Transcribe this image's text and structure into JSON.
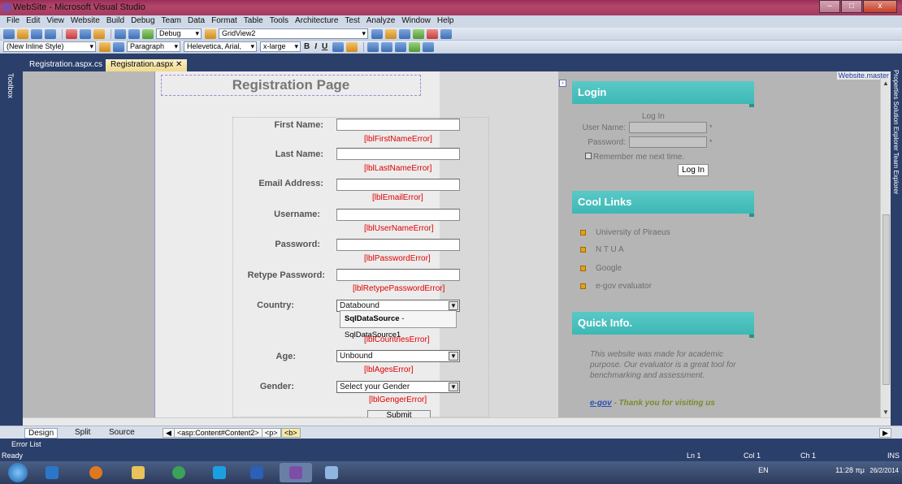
{
  "window": {
    "title": "WebSite - Microsoft Visual Studio"
  },
  "menu": [
    "File",
    "Edit",
    "View",
    "Website",
    "Build",
    "Debug",
    "Team",
    "Data",
    "Format",
    "Table",
    "Tools",
    "Architecture",
    "Test",
    "Analyze",
    "Window",
    "Help"
  ],
  "toolbar1": {
    "config": "Debug",
    "target": "GridView2"
  },
  "toolbar2": {
    "style": "(New Inline Style)",
    "block": "Paragraph",
    "font": "Helevetica, Arial,",
    "size": "x-large"
  },
  "tabs": [
    "Registration.aspx.cs",
    "Registration.aspx"
  ],
  "side": {
    "toolbox": "Toolbox",
    "right": "Properties   Solution Explorer   Team Explorer"
  },
  "master_label": "Website.master",
  "form": {
    "title": "Registration Page",
    "first_name": "First Name:",
    "first_name_err": "[lblFirstNameError]",
    "last_name": "Last Name:",
    "last_name_err": "[lblLastNameError]",
    "email": "Email Address:",
    "email_err": "[lblEmailError]",
    "username": "Username:",
    "username_err": "[lblUserNameError]",
    "password": "Password:",
    "password_err": "[lblPasswordError]",
    "retype": "Retype Password:",
    "retype_err": "[lblRetypePasswordError]",
    "country": "Country:",
    "country_value": "Databound",
    "country_err": "[lblCountriesError]",
    "sql_bold": "SqlDataSource",
    "sql_rest": " - SqlDataSource1",
    "age": "Age:",
    "age_value": "Unbound",
    "age_err": "[lblAgesError]",
    "gender": "Gender:",
    "gender_value": "Select your Gender",
    "gender_err": "[lblGengerError]",
    "submit": "Submit"
  },
  "sidebar": {
    "login_title": "Login",
    "login_head": "Log In",
    "user_label": "User Name:",
    "pass_label": "Password:",
    "star": "*",
    "remember": "Remember me next time.",
    "login_btn": "Log In",
    "links_title": "Cool Links",
    "links": [
      "University of Piraeus",
      "N T U A",
      "Google",
      "e-gov evaluator"
    ],
    "info_title": "Quick Info.",
    "info_text": "This website was made for academic purpose. Our evaluator is a great tool for benchmarking and assessment.",
    "info_link": "e-gov",
    "info_thanks": " - Thank you for visiting us"
  },
  "bottom": {
    "design": "Design",
    "split": "Split",
    "source": "Source",
    "crumbs": [
      "<asp:Content#Content2>",
      "<p>",
      "<b>"
    ],
    "error_list": "Error List"
  },
  "status": {
    "ready": "Ready",
    "ln": "Ln 1",
    "col": "Col 1",
    "ch": "Ch 1",
    "ins": "INS"
  },
  "tray": {
    "lang": "EN",
    "time": "11:28 πμ",
    "date": "26/2/2014"
  }
}
